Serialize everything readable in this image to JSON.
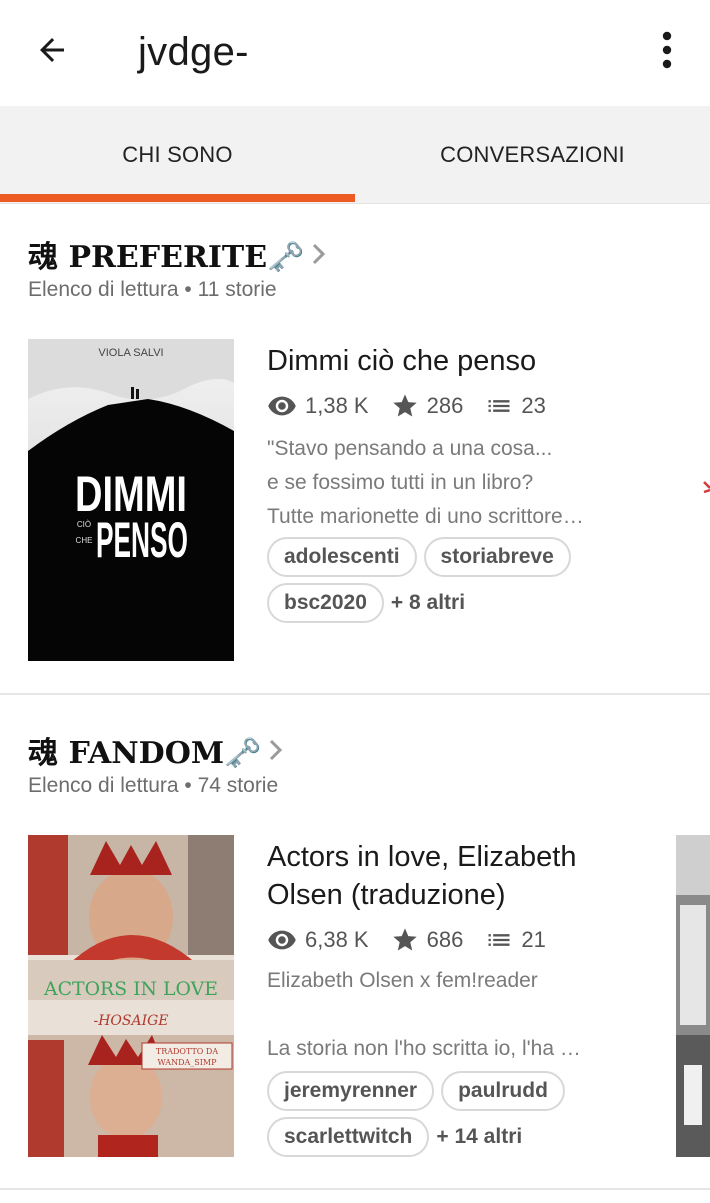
{
  "header": {
    "title": "jvdge-",
    "back_icon": "arrow-left-icon",
    "menu_icon": "more-vertical-icon"
  },
  "tabs": [
    {
      "label": "CHI SONO",
      "active": true
    },
    {
      "label": "CONVERSAZIONI",
      "active": false
    }
  ],
  "accent_color": "#ec5b24",
  "reading_lists": [
    {
      "title": "魂 PREFERITE🗝️",
      "meta": "Elenco di lettura • 11 storie",
      "story": {
        "title": "Dimmi ciò che penso",
        "reads": "1,38 K",
        "votes": "286",
        "parts": "23",
        "description": [
          "\"Stavo pensando a una cosa...",
          "e se fossimo tutti in un libro?",
          "Tutte marionette di uno scrittore…"
        ],
        "tags": [
          "adolescenti",
          "storiabreve",
          "bsc2020"
        ],
        "more_tags": "+ 8 altri",
        "cover": {
          "author": "VIOLA SALVI",
          "line1": "DIMMI",
          "small1": "CIÒ",
          "small2": "CHE",
          "line2": "PENSO"
        }
      }
    },
    {
      "title": "魂 FANDOM🗝️",
      "meta": "Elenco di lettura • 74 storie",
      "story": {
        "title": "Actors in love, Elizabeth Olsen (traduzione)",
        "reads": "6,38 K",
        "votes": "686",
        "parts": "21",
        "description": [
          "Elizabeth Olsen x fem!reader",
          "",
          "La storia non l'ho scritta io, l'ha …"
        ],
        "tags": [
          "jeremyrenner",
          "paulrudd",
          "scarlettwitch"
        ],
        "more_tags": "+ 14 altri",
        "cover": {
          "title": "ACTORS IN LOVE",
          "author": "-HOSAIGE",
          "credit1": "TRADOTTO DA",
          "credit2": "WANDA_SIMP"
        }
      }
    }
  ]
}
